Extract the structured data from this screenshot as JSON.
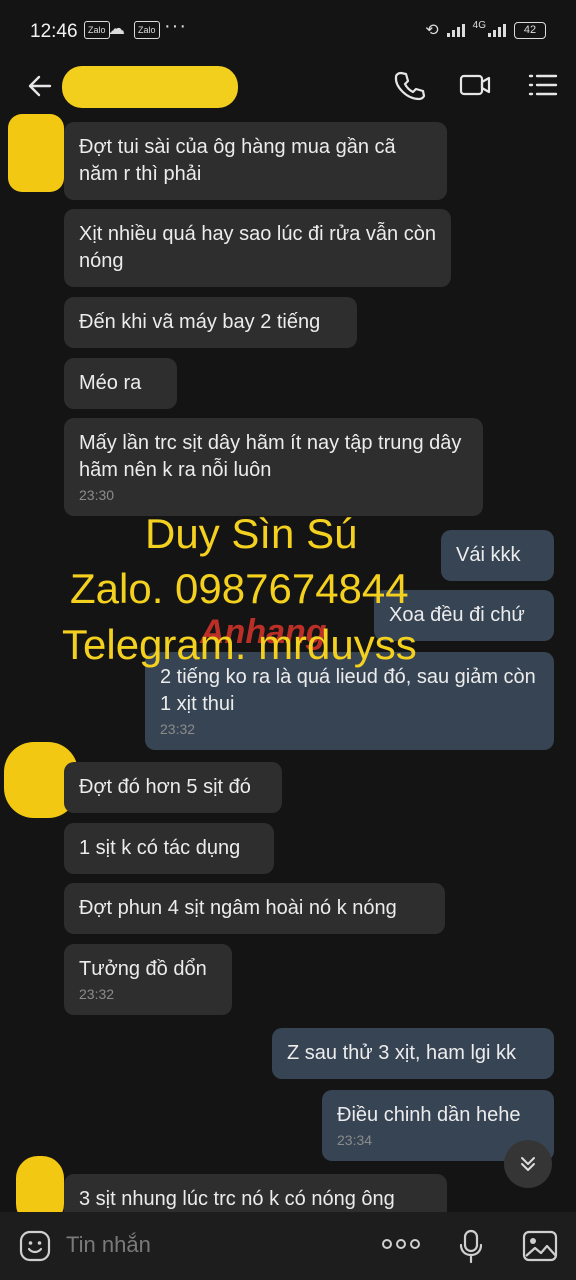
{
  "status_bar": {
    "time": "12:46",
    "app_icons": [
      "Zalo",
      "Zalo"
    ],
    "more": "···",
    "network": "4G",
    "battery": "42"
  },
  "header": {
    "back_icon": "arrow-left-icon",
    "call_icon": "phone-icon",
    "video_icon": "video-call-icon",
    "menu_icon": "menu-icon"
  },
  "messages": [
    {
      "dir": "in",
      "text": "Đợt tui sài của ôg hàng mua gần cã năm r thì phải"
    },
    {
      "dir": "in",
      "text": "Xịt nhiều quá hay sao lúc đi rửa vẫn còn nóng"
    },
    {
      "dir": "in",
      "text": "Đến khi vã máy bay 2 tiếng"
    },
    {
      "dir": "in",
      "text": "Méo ra"
    },
    {
      "dir": "in",
      "text": "Mấy lần trc sịt dây hãm ít nay tập trung dây hãm nên k ra nỗi luôn",
      "time": "23:30"
    },
    {
      "dir": "out",
      "text": "Vái kkk"
    },
    {
      "dir": "out",
      "text": "Xoa đều đi chứ"
    },
    {
      "dir": "out",
      "text": "2 tiếng ko ra là quá lieud đó, sau giảm còn 1 xịt thui",
      "time": "23:32"
    },
    {
      "dir": "in",
      "text": "Đợt đó hơn 5 sịt đó"
    },
    {
      "dir": "in",
      "text": "1 sịt k có tác dụng"
    },
    {
      "dir": "in",
      "text": "Đợt phun 4 sịt ngâm hoài nó k nóng"
    },
    {
      "dir": "in",
      "text": "Tưởng đồ dổn",
      "time": "23:32"
    },
    {
      "dir": "out",
      "text": "Z sau thử 3 xịt, ham lgi kk"
    },
    {
      "dir": "out",
      "text": "Điều chinh dần hehe",
      "time": "23:34"
    },
    {
      "dir": "in",
      "text": "3 sịt nhung lúc trc nó k có nóng ông"
    }
  ],
  "watermark": {
    "line1": "Duy Sìn Sú",
    "line2": "Zalo. 0987674844",
    "line3": "Telegram. mrduyss",
    "logo": "Anhang"
  },
  "input_bar": {
    "placeholder": "Tin nhắn",
    "emoji_icon": "emoji-icon",
    "more_icon": "more-dots-icon",
    "mic_icon": "microphone-icon",
    "image_icon": "image-icon"
  },
  "scroll_down_icon": "chevrons-down-icon",
  "colors": {
    "background": "#141414",
    "incoming": "#2e2e2e",
    "outgoing": "#374454",
    "redaction": "#f2cf1d"
  }
}
